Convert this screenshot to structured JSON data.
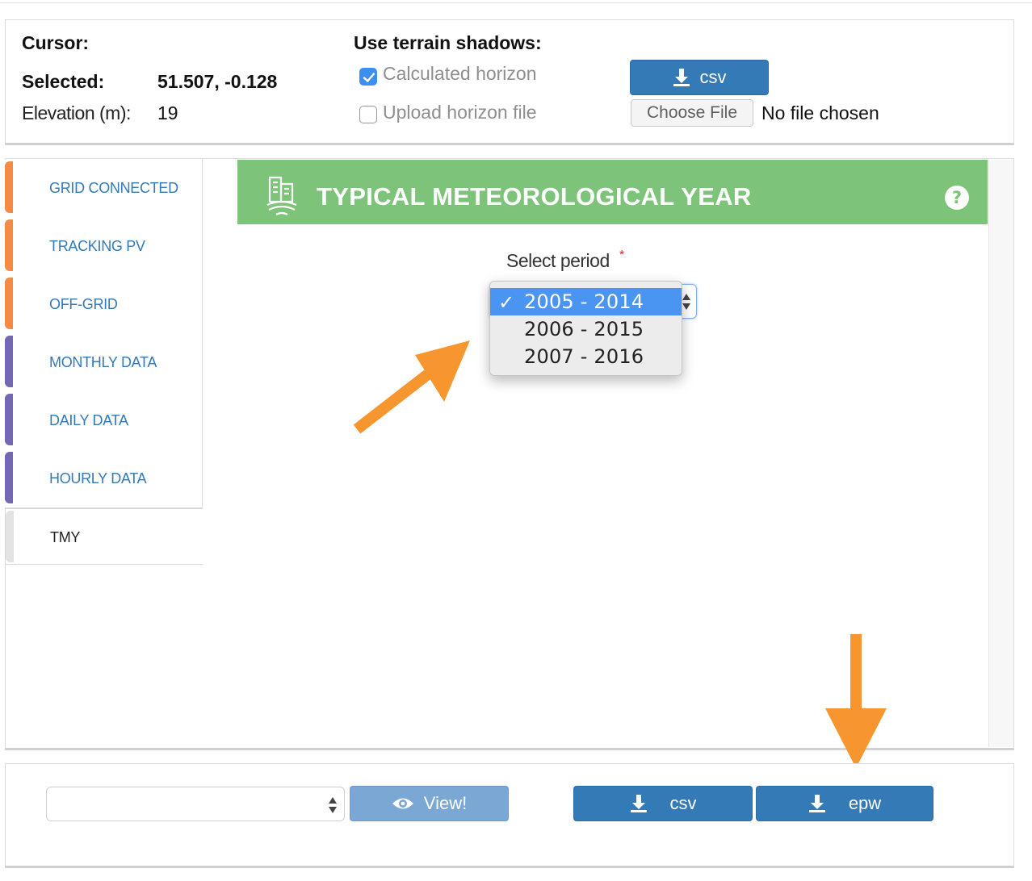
{
  "top": {
    "cursor_label": "Cursor:",
    "selected_label": "Selected:",
    "selected_value": "51.507, -0.128",
    "elevation_label": "Elevation (m):",
    "elevation_value": "19",
    "terrain_title": "Use terrain shadows:",
    "calculated_horizon": {
      "label": "Calculated horizon",
      "checked": true
    },
    "upload_horizon": {
      "label": "Upload horizon file",
      "checked": false
    },
    "csv_button": "csv",
    "choose_file_button": "Choose File",
    "no_file_text": "No file chosen"
  },
  "sidebar": {
    "tabs": [
      {
        "label": "GRID CONNECTED",
        "color": "#f58a42"
      },
      {
        "label": "TRACKING PV",
        "color": "#f58a42"
      },
      {
        "label": "OFF-GRID",
        "color": "#f58a42"
      },
      {
        "label": "MONTHLY DATA",
        "color": "#7268b5"
      },
      {
        "label": "DAILY DATA",
        "color": "#7268b5"
      },
      {
        "label": "HOURLY DATA",
        "color": "#7268b5"
      },
      {
        "label": "TMY",
        "color": "#e3e3e3",
        "active": true
      }
    ]
  },
  "tmy": {
    "title": "TYPICAL METEOROLOGICAL YEAR",
    "header_color": "#7dc47a",
    "select_label": "Select period",
    "required_mark": "*",
    "options": [
      "2005 - 2014",
      "2006 - 2015",
      "2007 - 2016"
    ],
    "selected_option": "2005 - 2014",
    "checkmark": "✓"
  },
  "bottom": {
    "view_button": "View!",
    "csv_button": "csv",
    "epw_button": "epw"
  },
  "colors": {
    "button_blue": "#337ab7",
    "link_blue": "#337ab7",
    "annotation_arrow": "#f7962e"
  }
}
